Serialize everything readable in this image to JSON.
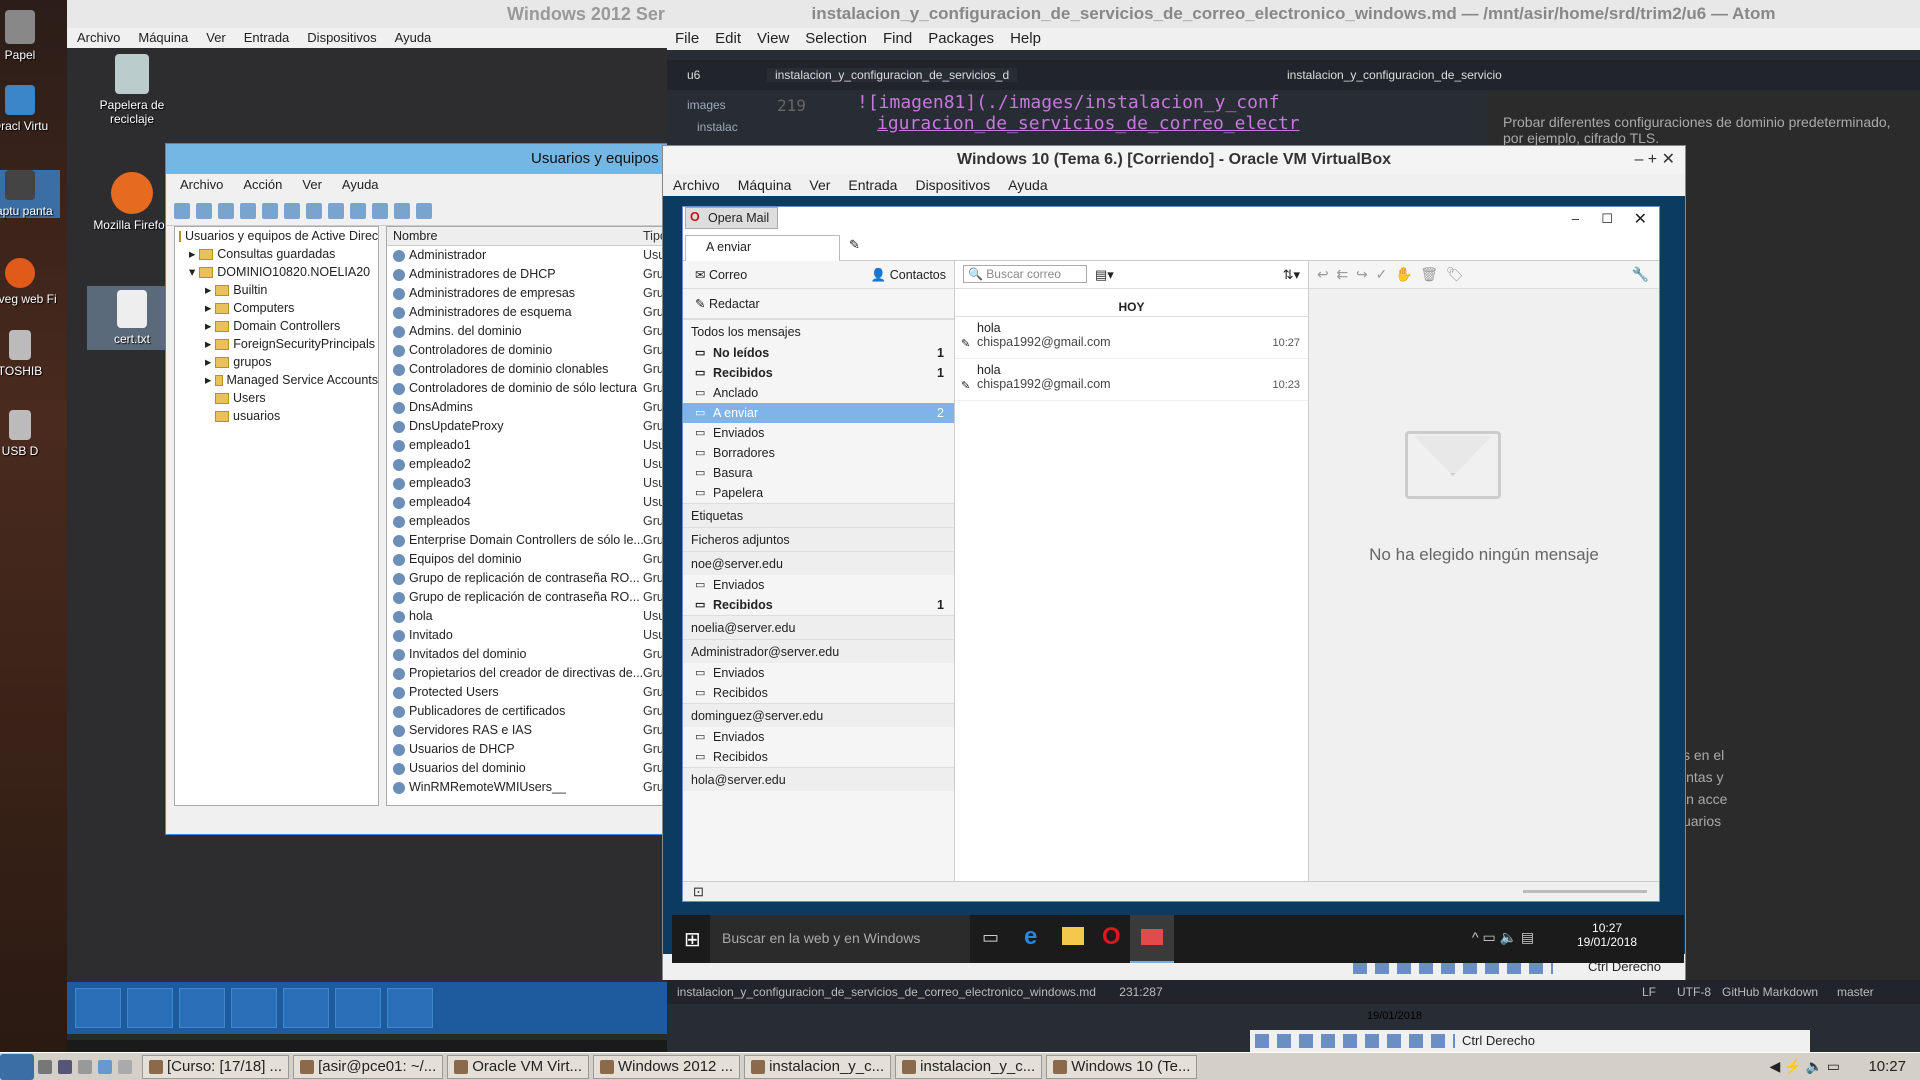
{
  "desktop": {
    "icons": [
      {
        "label": "Papel",
        "name": "papelera-icon-left"
      },
      {
        "label": "Oracl Virtu",
        "name": "virtualbox-desktop-icon"
      },
      {
        "label": "Captu panta",
        "name": "capture-desktop-icon"
      },
      {
        "label": "Naveg web Fi",
        "name": "browser-desktop-icon"
      },
      {
        "label": "TOSHIB",
        "name": "toshiba-drive-icon"
      },
      {
        "label": "USB D",
        "name": "usb-drive-icon"
      }
    ]
  },
  "win2012": {
    "title": "Windows 2012 Ser",
    "menu": [
      "Archivo",
      "Máquina",
      "Ver",
      "Entrada",
      "Dispositivos",
      "Ayuda"
    ],
    "desktop_icons": [
      {
        "label": "Papelera de reciclaje"
      },
      {
        "label": "Mozilla Firefox"
      },
      {
        "label": "cert.txt"
      }
    ],
    "aduc": {
      "title": "Usuarios y equipos",
      "menu": [
        "Archivo",
        "Acción",
        "Ver",
        "Ayuda"
      ],
      "tree": [
        "Usuarios y equipos de Active Direct",
        "Consultas guardadas",
        "DOMINIO10820.NOELIA20",
        "Builtin",
        "Computers",
        "Domain Controllers",
        "ForeignSecurityPrincipals",
        "grupos",
        "Managed Service Accounts",
        "Users",
        "usuarios"
      ],
      "columns": [
        "Nombre",
        "Tipo"
      ],
      "rows": [
        {
          "name": "Administrador",
          "type": "Usua"
        },
        {
          "name": "Administradores de DHCP",
          "type": "Grup"
        },
        {
          "name": "Administradores de empresas",
          "type": "Grup"
        },
        {
          "name": "Administradores de esquema",
          "type": "Grup"
        },
        {
          "name": "Admins. del dominio",
          "type": "Grup"
        },
        {
          "name": "Controladores de dominio",
          "type": "Grup"
        },
        {
          "name": "Controladores de dominio clonables",
          "type": "Grup"
        },
        {
          "name": "Controladores de dominio de sólo lectura",
          "type": "Grup"
        },
        {
          "name": "DnsAdmins",
          "type": "Grup"
        },
        {
          "name": "DnsUpdateProxy",
          "type": "Grup"
        },
        {
          "name": "empleado1",
          "type": "Usua"
        },
        {
          "name": "empleado2",
          "type": "Usua"
        },
        {
          "name": "empleado3",
          "type": "Usua"
        },
        {
          "name": "empleado4",
          "type": "Usua"
        },
        {
          "name": "empleados",
          "type": "Grup"
        },
        {
          "name": "Enterprise Domain Controllers de sólo le...",
          "type": "Grup"
        },
        {
          "name": "Equipos del dominio",
          "type": "Grup"
        },
        {
          "name": "Grupo de replicación de contraseña RO...",
          "type": "Grup"
        },
        {
          "name": "Grupo de replicación de contraseña RO...",
          "type": "Grup"
        },
        {
          "name": "hola",
          "type": "Usua"
        },
        {
          "name": "Invitado",
          "type": "Usua"
        },
        {
          "name": "Invitados del dominio",
          "type": "Grup"
        },
        {
          "name": "Propietarios del creador de directivas de...",
          "type": "Grup"
        },
        {
          "name": "Protected Users",
          "type": "Grup"
        },
        {
          "name": "Publicadores de certificados",
          "type": "Grup"
        },
        {
          "name": "Servidores RAS e IAS",
          "type": "Grup"
        },
        {
          "name": "Usuarios de DHCP",
          "type": "Grup"
        },
        {
          "name": "Usuarios del dominio",
          "type": "Grup"
        },
        {
          "name": "WinRMRemoteWMIUsers__",
          "type": "Grup"
        }
      ]
    }
  },
  "atom": {
    "title": "instalacion_y_configuracion_de_servicios_de_correo_electronico_windows.md — /mnt/asir/home/srd/trim2/u6 — Atom",
    "menu": [
      "File",
      "Edit",
      "View",
      "Selection",
      "Find",
      "Packages",
      "Help"
    ],
    "tree": [
      "u6",
      "images",
      "instalac"
    ],
    "tab_editor": "instalacion_y_configuracion_de_servicios_d",
    "tab_preview": "instalacion_y_configuracion_de_servicio",
    "line_number": "219",
    "code_line1": "![imagen81](./images/instalacion_y_conf",
    "code_line2": "iguracion_de_servicios_de_correo_electr",
    "preview_top": "Probar diferentes configuraciones de dominio predeterminado, por ejemplo, cifrado TLS.",
    "preview_lines": [
      "n los parámetros especificados en el",
      "esde / hacia las diferentes cuentas y",
      "lroot. En este caso sólo tendrán acce",
      "minio y correspondientes a usuarios"
    ],
    "status_file": "instalacion_y_configuracion_de_servicios_de_correo_electronico_windows.md",
    "status_pos": "231:287",
    "status_right": [
      "LF",
      "UTF-8",
      "GitHub Markdown",
      "master"
    ],
    "preview_date": "19/01/2018"
  },
  "vbox": {
    "title": "Windows 10 (Tema 6.) [Corriendo] - Oracle VM VirtualBox",
    "menu": [
      "Archivo",
      "Máquina",
      "Ver",
      "Entrada",
      "Dispositivos",
      "Ayuda"
    ],
    "host_key": "Ctrl Derecho"
  },
  "opera": {
    "app_button": "Opera Mail",
    "tab": "A enviar",
    "mail_btn": "Correo",
    "contacts_btn": "Contactos",
    "compose_btn": "Redactar",
    "search_placeholder": "Buscar correo",
    "all_messages": "Todos los mensajes",
    "folders": [
      {
        "label": "No leídos",
        "count": "1",
        "bold": true
      },
      {
        "label": "Recibidos",
        "count": "1",
        "bold": true
      },
      {
        "label": "Anclado",
        "count": ""
      },
      {
        "label": "A enviar",
        "count": "2",
        "selected": true
      },
      {
        "label": "Enviados",
        "count": ""
      },
      {
        "label": "Borradores",
        "count": ""
      },
      {
        "label": "Basura",
        "count": ""
      },
      {
        "label": "Papelera",
        "count": ""
      }
    ],
    "labels_header": "Etiquetas",
    "attachments_header": "Ficheros adjuntos",
    "accounts": [
      {
        "name": "noe@server.edu",
        "folders": [
          {
            "label": "Enviados",
            "count": ""
          },
          {
            "label": "Recibidos",
            "count": "1",
            "bold": true
          }
        ]
      },
      {
        "name": "noelia@server.edu",
        "folders": []
      },
      {
        "name": "Administrador@server.edu",
        "folders": [
          {
            "label": "Enviados",
            "count": ""
          },
          {
            "label": "Recibidos",
            "count": ""
          }
        ]
      },
      {
        "name": "dominguez@server.edu",
        "folders": [
          {
            "label": "Enviados",
            "count": ""
          },
          {
            "label": "Recibidos",
            "count": ""
          }
        ]
      },
      {
        "name": "hola@server.edu",
        "folders": []
      }
    ],
    "list_header": "HOY",
    "messages": [
      {
        "subject": "hola",
        "from": "chispa1992@gmail.com",
        "time": "10:27"
      },
      {
        "subject": "hola",
        "from": "chispa1992@gmail.com",
        "time": "10:23"
      }
    ],
    "empty_text": "No ha elegido ningún mensaje"
  },
  "win10taskbar": {
    "search_placeholder": "Buscar en la web y en Windows",
    "time": "10:27",
    "date": "19/01/2018"
  },
  "host_taskbar": {
    "items": [
      "[Curso: [17/18] ...",
      "[asir@pce01: ~/...",
      "Oracle VM Virt...",
      "Windows 2012 ...",
      "instalacion_y_c...",
      "instalacion_y_c...",
      "Windows 10 (Te..."
    ],
    "clock": "10:27",
    "host_key_small": "Ctrl Derecho"
  },
  "colors": {
    "aduc_title": "#74b6e4",
    "selected_folder": "#7eb4ea",
    "opera_red": "#cc0f16"
  }
}
